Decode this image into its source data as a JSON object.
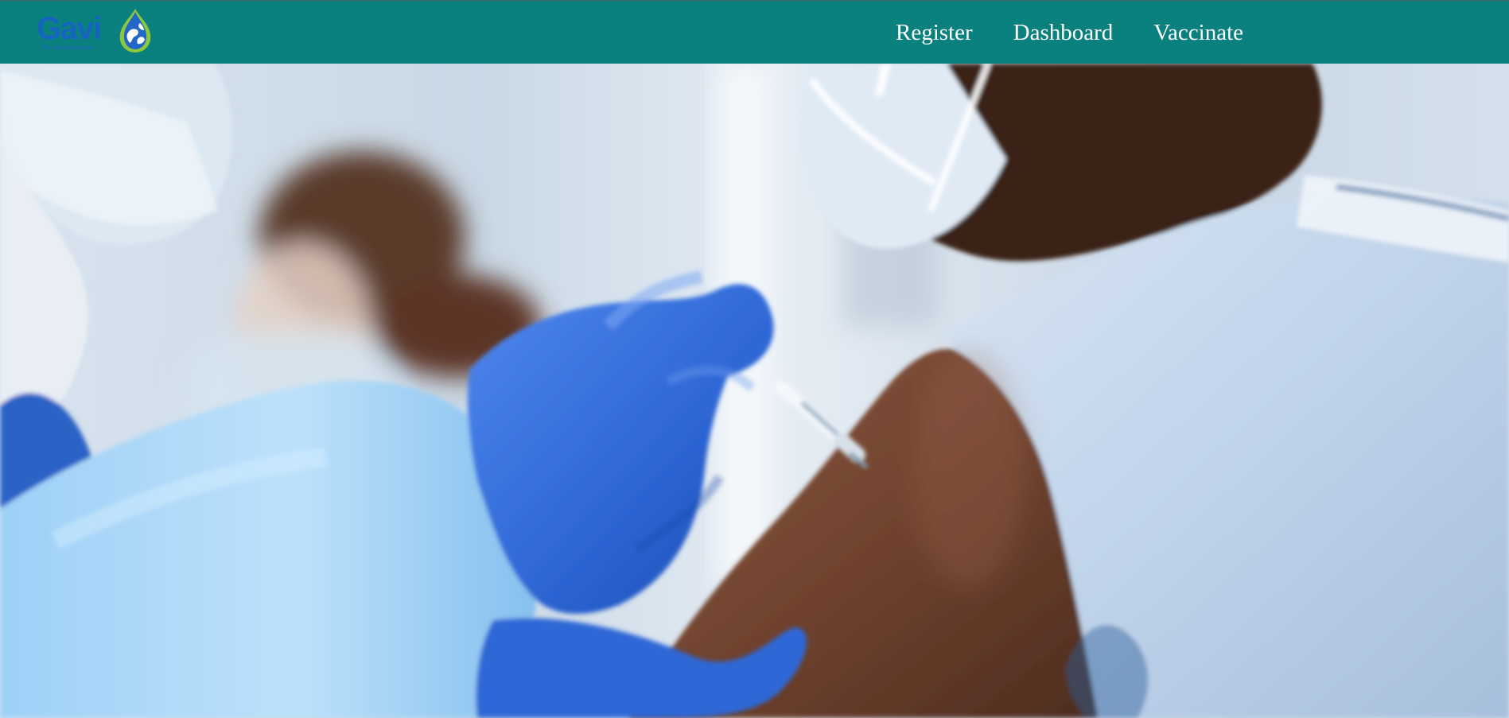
{
  "brand": {
    "wordmark": "Gavi",
    "tagline": "The Vaccine Alliance",
    "logo_icon": "globe-drop-icon",
    "colors": {
      "navbar": "#0b817f",
      "wordmark": "#1565c0",
      "drop_blue": "#1f66c8",
      "drop_green": "#8dc63f"
    }
  },
  "nav": {
    "links": [
      {
        "label": "Register"
      },
      {
        "label": "Dashboard"
      },
      {
        "label": "Vaccinate"
      }
    ]
  },
  "hero": {
    "image_description": "Health worker in blue gloves administering a vaccine injection into a masked patient's upper arm"
  }
}
